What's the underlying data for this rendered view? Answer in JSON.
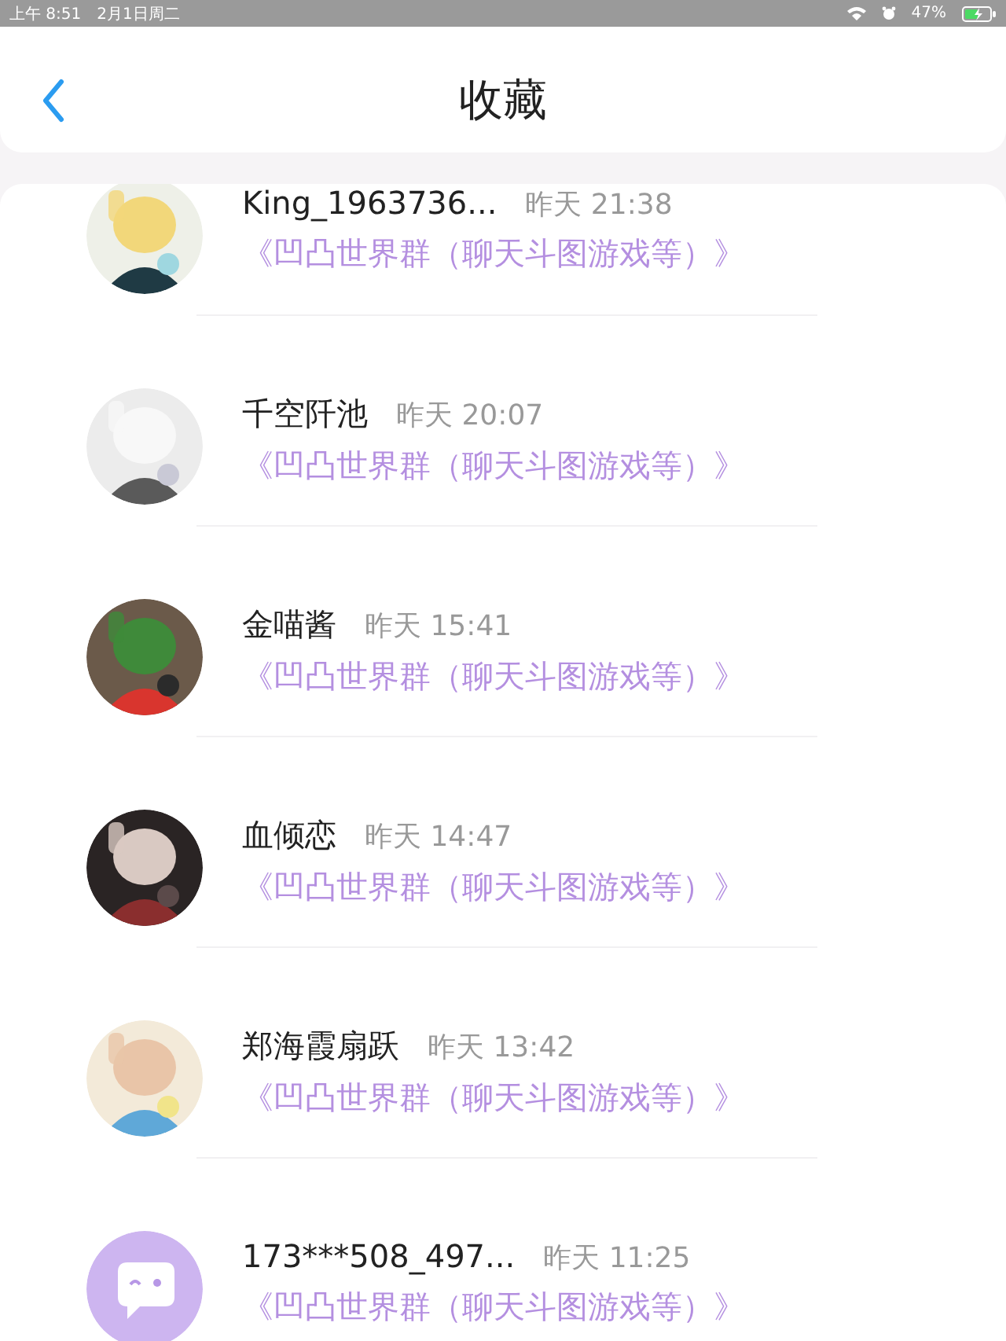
{
  "status_bar": {
    "time": "上午 8:51",
    "date": "2月1日周二",
    "battery": "47%"
  },
  "header": {
    "title": "收藏"
  },
  "favorites": [
    {
      "name": "King_1963736...",
      "time": "昨天 21:38",
      "group": "《凹凸世界群（聊天斗图游戏等）》"
    },
    {
      "name": "千空阡池",
      "time": "昨天 20:07",
      "group": "《凹凸世界群（聊天斗图游戏等）》"
    },
    {
      "name": "金喵酱",
      "time": "昨天 15:41",
      "group": "《凹凸世界群（聊天斗图游戏等）》"
    },
    {
      "name": "血倾恋",
      "time": "昨天 14:47",
      "group": "《凹凸世界群（聊天斗图游戏等）》"
    },
    {
      "name": "郑海霞扇跃",
      "time": "昨天 13:42",
      "group": "《凹凸世界群（聊天斗图游戏等）》"
    },
    {
      "avatar": {
        "kind": "default"
      },
      "name": "173***508_497...",
      "time": "昨天 11:25",
      "group": "《凹凸世界群（聊天斗图游戏等）》"
    }
  ]
}
